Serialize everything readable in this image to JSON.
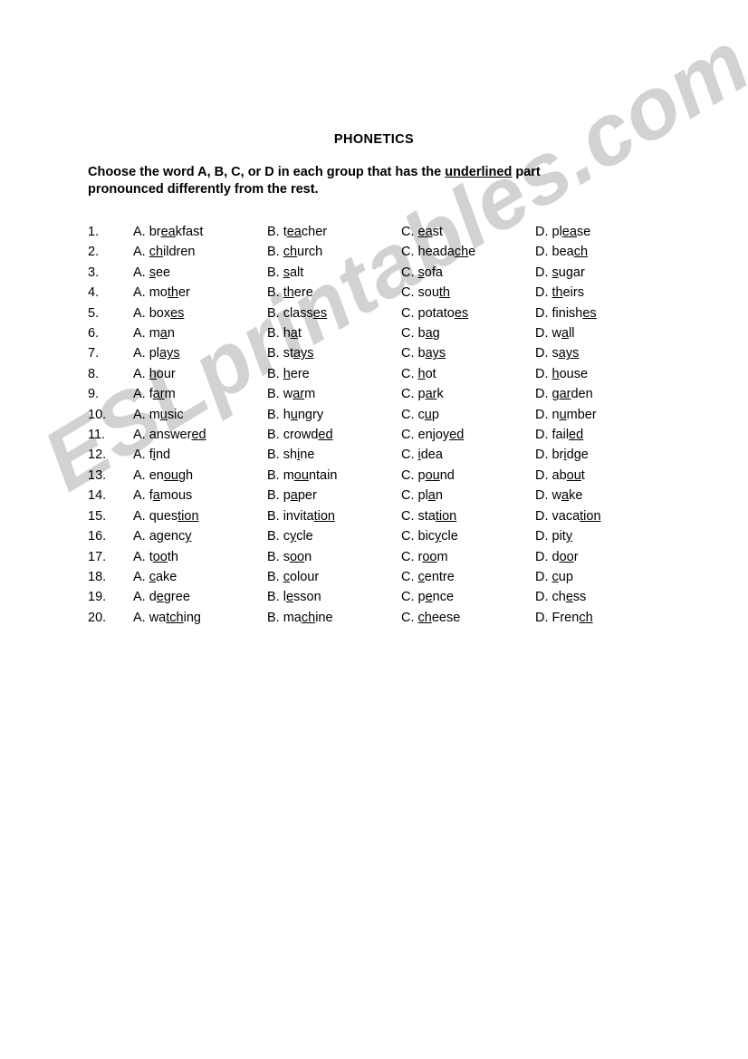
{
  "page": {
    "title": "PHONETICS",
    "watermark": "ESLprintables.com",
    "watermark_color": "#d2d2d2",
    "background_color": "#ffffff",
    "text_color": "#000000"
  },
  "instructions": {
    "line1_before": "Choose the word A, B, C, or D in each group that has the ",
    "line1_underlined": "underlined",
    "line1_after": " part",
    "line2": "pronounced differently from the rest."
  },
  "option_letters": [
    "A.",
    "B.",
    "C.",
    "D."
  ],
  "questions": [
    {
      "number": "1.",
      "options": [
        {
          "pre": "br",
          "mark": "ea",
          "post": "kfast"
        },
        {
          "pre": "t",
          "mark": "ea",
          "post": "cher"
        },
        {
          "pre": "",
          "mark": "ea",
          "post": "st"
        },
        {
          "pre": "pl",
          "mark": "ea",
          "post": "se"
        }
      ]
    },
    {
      "number": "2.",
      "options": [
        {
          "pre": "",
          "mark": "ch",
          "post": "ildren"
        },
        {
          "pre": "",
          "mark": "ch",
          "post": "urch"
        },
        {
          "pre": "heada",
          "mark": "ch",
          "post": "e"
        },
        {
          "pre": "bea",
          "mark": "ch",
          "post": ""
        }
      ]
    },
    {
      "number": "3.",
      "options": [
        {
          "pre": "",
          "mark": "s",
          "post": "ee"
        },
        {
          "pre": "",
          "mark": "s",
          "post": "alt"
        },
        {
          "pre": "",
          "mark": "s",
          "post": "ofa"
        },
        {
          "pre": "",
          "mark": "s",
          "post": "ugar"
        }
      ]
    },
    {
      "number": "4.",
      "options": [
        {
          "pre": "mo",
          "mark": "th",
          "post": "er"
        },
        {
          "pre": "",
          "mark": "th",
          "post": "ere"
        },
        {
          "pre": "sou",
          "mark": "th",
          "post": ""
        },
        {
          "pre": "",
          "mark": "th",
          "post": "eirs"
        }
      ]
    },
    {
      "number": "5.",
      "options": [
        {
          "pre": "box",
          "mark": "es",
          "post": ""
        },
        {
          "pre": "class",
          "mark": "es",
          "post": ""
        },
        {
          "pre": "potato",
          "mark": "es",
          "post": ""
        },
        {
          "pre": "finish",
          "mark": "es",
          "post": ""
        }
      ]
    },
    {
      "number": "6.",
      "options": [
        {
          "pre": "m",
          "mark": "a",
          "post": "n"
        },
        {
          "pre": "h",
          "mark": "a",
          "post": "t"
        },
        {
          "pre": "b",
          "mark": "a",
          "post": "g"
        },
        {
          "pre": "w",
          "mark": "a",
          "post": "ll"
        }
      ]
    },
    {
      "number": "7.",
      "options": [
        {
          "pre": "pl",
          "mark": "ays",
          "post": ""
        },
        {
          "pre": "st",
          "mark": "ays",
          "post": ""
        },
        {
          "pre": "b",
          "mark": "ays",
          "post": ""
        },
        {
          "pre": "s",
          "mark": "ays",
          "post": ""
        }
      ]
    },
    {
      "number": "8.",
      "options": [
        {
          "pre": "",
          "mark": "h",
          "post": "our"
        },
        {
          "pre": "",
          "mark": "h",
          "post": "ere"
        },
        {
          "pre": "",
          "mark": "h",
          "post": "ot"
        },
        {
          "pre": "",
          "mark": "h",
          "post": "ouse"
        }
      ]
    },
    {
      "number": "9.",
      "options": [
        {
          "pre": "f",
          "mark": "ar",
          "post": "m"
        },
        {
          "pre": "w",
          "mark": "ar",
          "post": "m"
        },
        {
          "pre": "p",
          "mark": "ar",
          "post": "k"
        },
        {
          "pre": "g",
          "mark": "ar",
          "post": "den"
        }
      ]
    },
    {
      "number": "10.",
      "options": [
        {
          "pre": "m",
          "mark": "u",
          "post": "sic"
        },
        {
          "pre": "h",
          "mark": "u",
          "post": "ngry"
        },
        {
          "pre": "c",
          "mark": "u",
          "post": "p"
        },
        {
          "pre": "n",
          "mark": "u",
          "post": "mber"
        }
      ]
    },
    {
      "number": "11.",
      "options": [
        {
          "pre": "answer",
          "mark": "ed",
          "post": ""
        },
        {
          "pre": "crowd",
          "mark": "ed",
          "post": ""
        },
        {
          "pre": "enjoy",
          "mark": "ed",
          "post": ""
        },
        {
          "pre": "fail",
          "mark": "ed",
          "post": ""
        }
      ]
    },
    {
      "number": "12.",
      "options": [
        {
          "pre": "f",
          "mark": "i",
          "post": "nd"
        },
        {
          "pre": "sh",
          "mark": "i",
          "post": "ne"
        },
        {
          "pre": "",
          "mark": "i",
          "post": "dea"
        },
        {
          "pre": "br",
          "mark": "i",
          "post": "dge"
        }
      ]
    },
    {
      "number": "13.",
      "options": [
        {
          "pre": "en",
          "mark": "ou",
          "post": "gh"
        },
        {
          "pre": "m",
          "mark": "ou",
          "post": "ntain"
        },
        {
          "pre": "p",
          "mark": "ou",
          "post": "nd"
        },
        {
          "pre": "ab",
          "mark": "ou",
          "post": "t"
        }
      ]
    },
    {
      "number": "14.",
      "options": [
        {
          "pre": "f",
          "mark": "a",
          "post": "mous"
        },
        {
          "pre": "p",
          "mark": "a",
          "post": "per"
        },
        {
          "pre": "pl",
          "mark": "a",
          "post": "n"
        },
        {
          "pre": "w",
          "mark": "a",
          "post": "ke"
        }
      ]
    },
    {
      "number": "15.",
      "options": [
        {
          "pre": "ques",
          "mark": "tion",
          "post": ""
        },
        {
          "pre": "invita",
          "mark": "tion",
          "post": ""
        },
        {
          "pre": "sta",
          "mark": "tion",
          "post": ""
        },
        {
          "pre": "vaca",
          "mark": "tion",
          "post": ""
        }
      ]
    },
    {
      "number": "16.",
      "options": [
        {
          "pre": "agenc",
          "mark": "y",
          "post": ""
        },
        {
          "pre": "c",
          "mark": "y",
          "post": "cle"
        },
        {
          "pre": "bic",
          "mark": "y",
          "post": "cle"
        },
        {
          "pre": "pit",
          "mark": "y",
          "post": ""
        }
      ]
    },
    {
      "number": "17.",
      "options": [
        {
          "pre": "t",
          "mark": "oo",
          "post": "th"
        },
        {
          "pre": "s",
          "mark": "oo",
          "post": "n"
        },
        {
          "pre": "r",
          "mark": "oo",
          "post": "m"
        },
        {
          "pre": "d",
          "mark": "oo",
          "post": "r"
        }
      ]
    },
    {
      "number": "18.",
      "options": [
        {
          "pre": "",
          "mark": "c",
          "post": "ake"
        },
        {
          "pre": "",
          "mark": "c",
          "post": "olour"
        },
        {
          "pre": "",
          "mark": "c",
          "post": "entre"
        },
        {
          "pre": "",
          "mark": "c",
          "post": "up"
        }
      ]
    },
    {
      "number": "19.",
      "options": [
        {
          "pre": "d",
          "mark": "e",
          "post": "gree"
        },
        {
          "pre": "l",
          "mark": "e",
          "post": "sson"
        },
        {
          "pre": "p",
          "mark": "e",
          "post": "nce"
        },
        {
          "pre": "ch",
          "mark": "e",
          "post": "ss"
        }
      ]
    },
    {
      "number": "20.",
      "options": [
        {
          "pre": "wa",
          "mark": "tch",
          "post": "ing"
        },
        {
          "pre": "ma",
          "mark": "ch",
          "post": "ine"
        },
        {
          "pre": "",
          "mark": "ch",
          "post": "eese"
        },
        {
          "pre": "Fren",
          "mark": "ch",
          "post": ""
        }
      ]
    }
  ]
}
